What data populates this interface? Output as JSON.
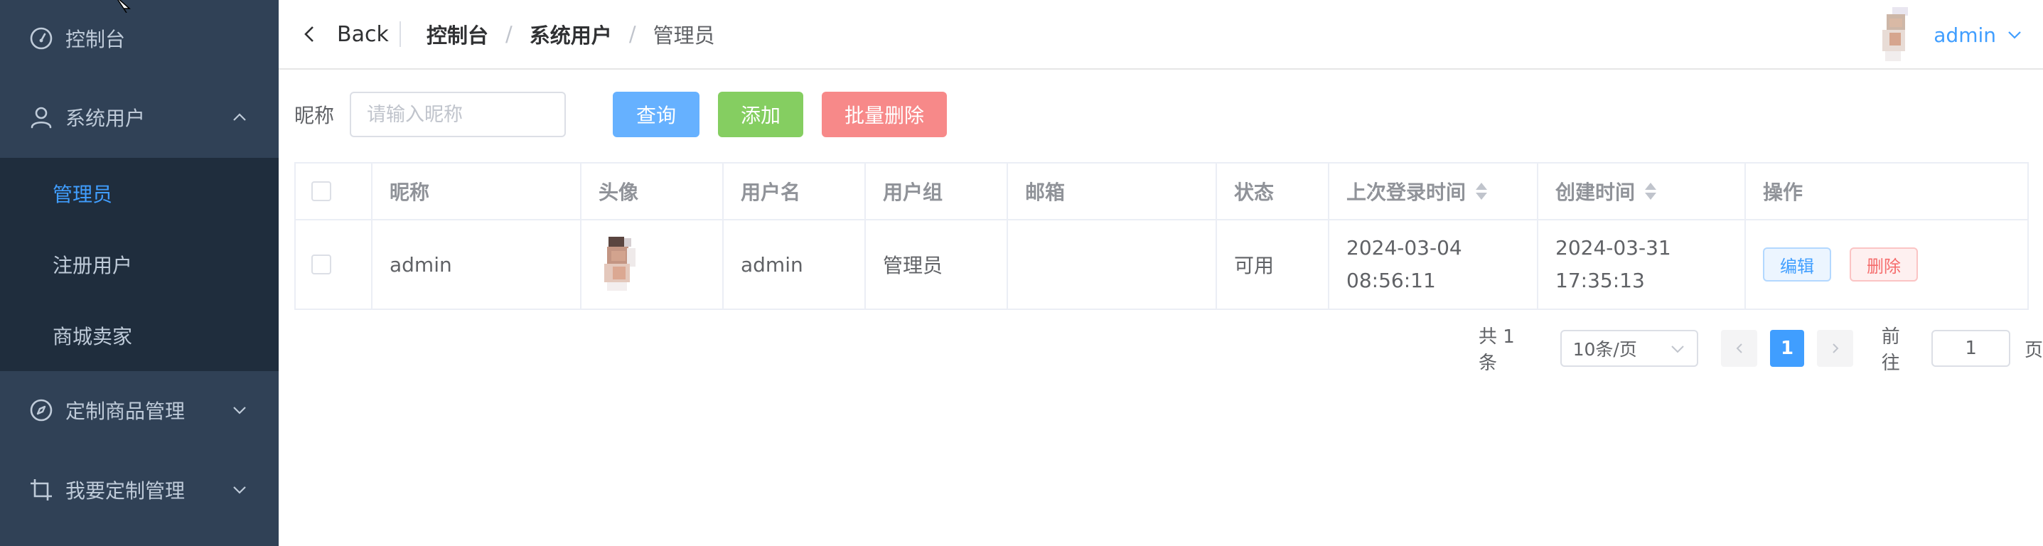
{
  "sidebar": {
    "items": [
      {
        "label": "控制台",
        "icon": "dashboard-icon"
      },
      {
        "label": "系统用户",
        "icon": "user-icon",
        "expanded": true,
        "children": [
          {
            "label": "管理员",
            "active": true
          },
          {
            "label": "注册用户"
          },
          {
            "label": "商城卖家"
          }
        ]
      },
      {
        "label": "定制商品管理",
        "icon": "compass-icon"
      },
      {
        "label": "我要定制管理",
        "icon": "crop-icon"
      }
    ]
  },
  "header": {
    "back_label": "Back",
    "breadcrumb": [
      "控制台",
      "系统用户",
      "管理员"
    ],
    "separator": "/",
    "username": "admin"
  },
  "search": {
    "label": "昵称",
    "placeholder": "请输入昵称",
    "query_label": "查询",
    "add_label": "添加",
    "batch_delete_label": "批量删除"
  },
  "table": {
    "columns": [
      "昵称",
      "头像",
      "用户名",
      "用户组",
      "邮箱",
      "状态",
      "上次登录时间",
      "创建时间",
      "操作"
    ],
    "rows": [
      {
        "nickname": "admin",
        "username": "admin",
        "group": "管理员",
        "email": "",
        "status": "可用",
        "last_login_date": "2024-03-04",
        "last_login_time": "08:56:11",
        "created_date": "2024-03-31",
        "created_time": "17:35:13",
        "edit_label": "编辑",
        "delete_label": "删除"
      }
    ]
  },
  "pagination": {
    "total_text": "共 1 条",
    "page_size": "10条/页",
    "current_page": "1",
    "goto_label": "前往",
    "goto_value": "1",
    "page_suffix": "页"
  },
  "colors": {
    "sidebar_bg": "#304156",
    "submenu_bg": "#1f2d3d",
    "accent": "#409eff",
    "success": "#85ce61",
    "danger": "#f78989"
  }
}
